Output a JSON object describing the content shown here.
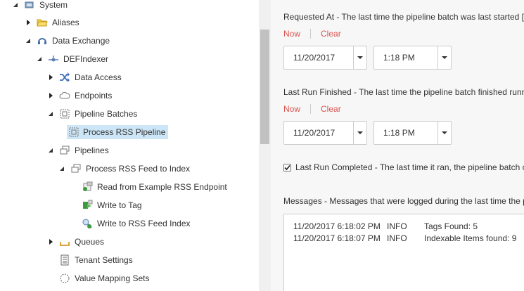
{
  "tree": {
    "items": [
      {
        "label": "System",
        "icon": "system-icon"
      },
      {
        "label": "Aliases",
        "icon": "folder-icon"
      },
      {
        "label": "Data Exchange",
        "icon": "data-exchange-icon"
      },
      {
        "label": "DEFIndexer",
        "icon": "indexer-icon"
      },
      {
        "label": "Data Access",
        "icon": "shuffle-icon"
      },
      {
        "label": "Endpoints",
        "icon": "cloud-icon"
      },
      {
        "label": "Pipeline Batches",
        "icon": "batch-icon"
      },
      {
        "label": "Process RSS Pipeline",
        "icon": "batch-item-icon"
      },
      {
        "label": "Pipelines",
        "icon": "pipelines-icon"
      },
      {
        "label": "Process RSS Feed to Index",
        "icon": "pipeline-icon"
      },
      {
        "label": "Read from Example RSS Endpoint",
        "icon": "read-step-icon"
      },
      {
        "label": "Write to Tag",
        "icon": "write-tag-icon"
      },
      {
        "label": "Write to RSS Feed Index",
        "icon": "write-index-icon"
      },
      {
        "label": "Queues",
        "icon": "queue-icon"
      },
      {
        "label": "Tenant Settings",
        "icon": "settings-doc-icon"
      },
      {
        "label": "Value Mapping Sets",
        "icon": "circle-icon"
      }
    ],
    "selected": "Process RSS Pipeline"
  },
  "form": {
    "requested_at": {
      "label": "Requested At - The last time the pipeline batch was last started [",
      "now": "Now",
      "clear": "Clear",
      "date": "11/20/2017",
      "time": "1:18 PM"
    },
    "last_run_finished": {
      "label": "Last Run Finished - The last time the pipeline batch finished runn",
      "now": "Now",
      "clear": "Clear",
      "date": "11/20/2017",
      "time": "1:18 PM"
    },
    "last_run_completed": {
      "label": "Last Run Completed - The last time it ran, the pipeline batch c",
      "checked": true
    },
    "messages": {
      "label": "Messages - Messages that were logged during the last time the p",
      "rows": [
        {
          "timestamp": "11/20/2017 6:18:02 PM",
          "level": "INFO",
          "text": "Tags Found: 5"
        },
        {
          "timestamp": "11/20/2017 6:18:07 PM",
          "level": "INFO",
          "text": "Indexable Items found: 9"
        }
      ]
    }
  },
  "colors": {
    "selected_bg": "#cde6f7",
    "link_red": "#d9534f",
    "right_bg": "#f7f7f7"
  }
}
